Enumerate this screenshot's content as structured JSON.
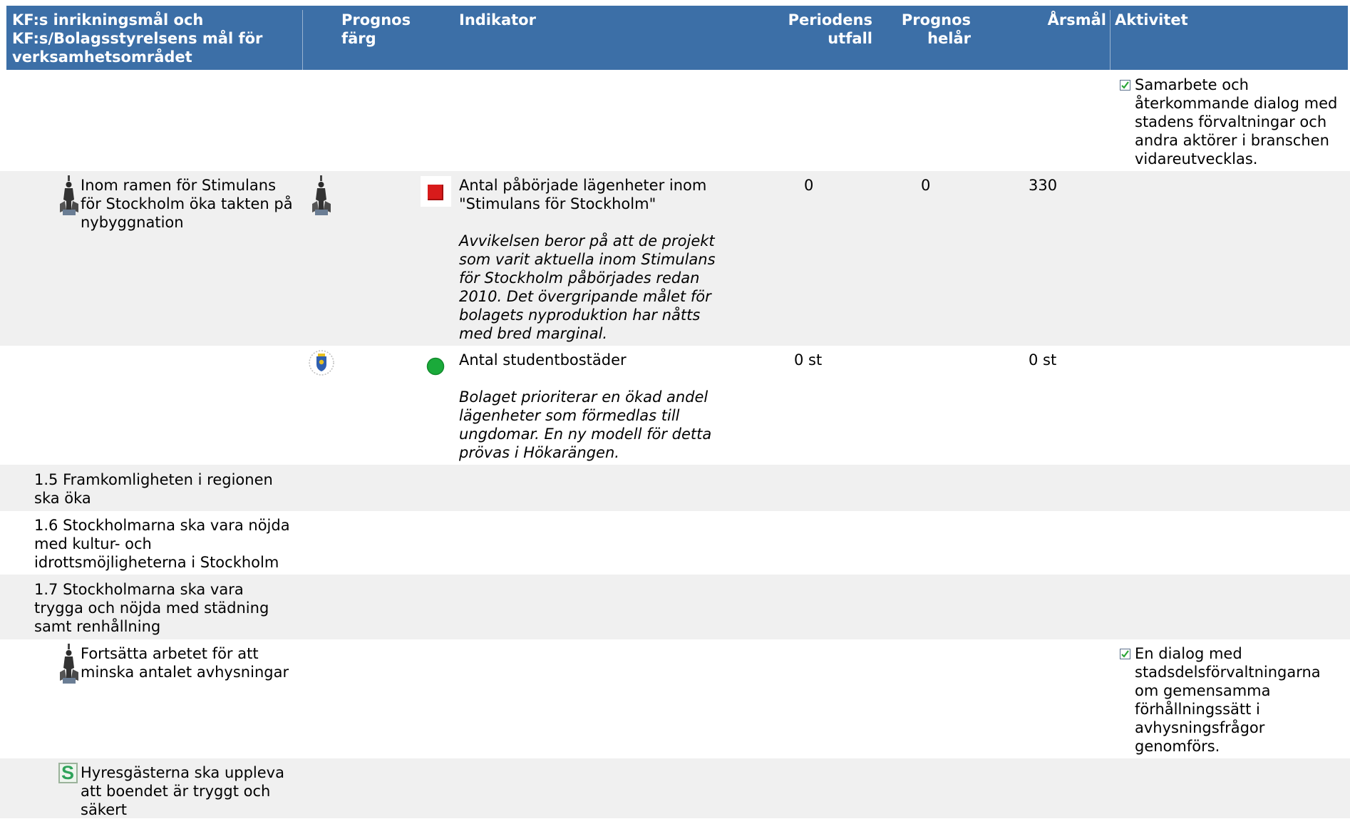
{
  "header": {
    "col_goal": [
      "KF:s inrikningsmål och",
      "KF:s/Bolagsstyrelsens mål för",
      "verksamhetsområdet"
    ],
    "col_prognos_farg": [
      "Prognos",
      "färg"
    ],
    "col_indikator": "Indikator",
    "col_periodens_utfall": [
      "Periodens",
      "utfall"
    ],
    "col_prognos_helar": [
      "Prognos",
      "helår"
    ],
    "col_arsmal": "Årsmål",
    "col_aktivitet": "Aktivitet"
  },
  "rows": {
    "row0": {
      "activity": [
        "Samarbete och",
        "återkommande dialog med",
        "stadens förvaltningar och",
        "andra aktörer i branschen",
        "vidareutvecklas."
      ],
      "activity_icon": "checkbox-check-icon"
    },
    "row1": {
      "goal": [
        "Inom ramen för Stimulans",
        "för Stockholm öka takten på",
        "nybyggnation"
      ],
      "goal_icon": "statue-icon",
      "source_icon": "statue-icon",
      "status_color": "#d81b1b",
      "status_icon": "red-square-icon",
      "indicator": [
        "Antal påbörjade lägenheter inom",
        "\"Stimulans för Stockholm\""
      ],
      "comment": [
        "Avvikelsen beror på att de projekt",
        "som varit aktuella inom Stimulans",
        "för Stockholm påbörjades redan",
        "2010. Det övergripande målet för",
        "bolagets nyproduktion har nåtts",
        "med bred marginal."
      ],
      "period_outcome": "0",
      "forecast_year": "0",
      "annual_goal": "330"
    },
    "row2": {
      "source_icon": "city-emblem-icon",
      "status_color": "#1aaa3a",
      "status_icon": "green-circle-icon",
      "indicator": "Antal studentbostäder",
      "comment": [
        "Bolaget prioriterar en ökad andel",
        "lägenheter som förmedlas till",
        "ungdomar. En ny modell för detta",
        "prövas i Hökarängen."
      ],
      "period_outcome": "0 st",
      "annual_goal": "0 st"
    },
    "row3": {
      "goal": [
        "1.5 Framkomligheten i regionen",
        "ska öka"
      ]
    },
    "row4": {
      "goal": [
        "1.6 Stockholmarna ska vara nöjda",
        "med kultur- och",
        "idrottsmöjligheterna i Stockholm"
      ]
    },
    "row5": {
      "goal": [
        "1.7 Stockholmarna ska vara",
        "trygga och nöjda med städning",
        "samt renhållning"
      ]
    },
    "row6": {
      "goal": [
        "Fortsätta arbetet för att",
        "minska antalet avhysningar"
      ],
      "goal_icon": "statue-icon",
      "activity": [
        "En dialog med",
        "stadsdelsförvaltningarna",
        "om gemensamma",
        "förhållningssätt i",
        "avhysningsfrågor",
        "genomförs."
      ],
      "activity_icon": "checkbox-check-icon"
    },
    "row7": {
      "goal": [
        "Hyresgästerna ska uppleva",
        "att boendet är tryggt och",
        "säkert"
      ],
      "goal_icon": "letter-s-icon",
      "goal_icon_letter": "S"
    }
  }
}
